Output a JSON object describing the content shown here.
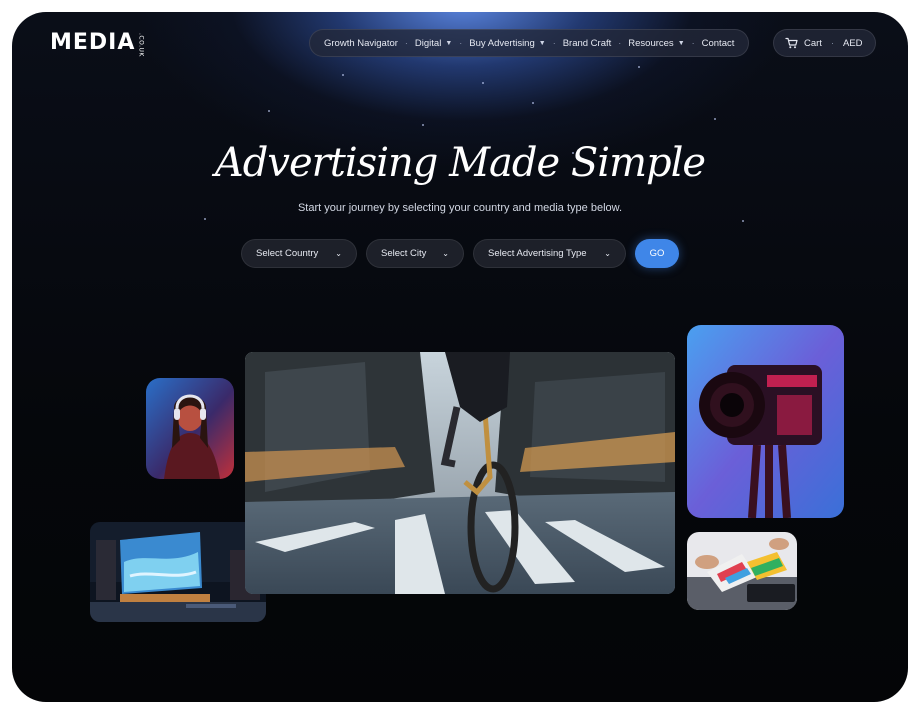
{
  "logo": {
    "text": "MEDIA",
    "suffix": ".CO.UK"
  },
  "nav": {
    "items": [
      {
        "label": "Growth Navigator",
        "dropdown": false
      },
      {
        "label": "Digital",
        "dropdown": true
      },
      {
        "label": "Buy Advertising",
        "dropdown": true
      },
      {
        "label": "Brand Craft",
        "dropdown": false
      },
      {
        "label": "Resources",
        "dropdown": true
      },
      {
        "label": "Contact",
        "dropdown": false
      }
    ]
  },
  "cart": {
    "label": "Cart",
    "currency": "AED"
  },
  "hero": {
    "title": "Advertising Made Simple",
    "subtitle": "Start your journey by selecting your country and media type below."
  },
  "filters": {
    "country_placeholder": "Select Country",
    "city_placeholder": "Select City",
    "type_placeholder": "Select Advertising Type",
    "go_label": "GO"
  },
  "icons": {
    "chevron": "chevron-down-icon",
    "cart": "cart-icon"
  },
  "colors": {
    "accent": "#3f86e8",
    "background": "#05070b",
    "glow": "#5f8ceb"
  }
}
